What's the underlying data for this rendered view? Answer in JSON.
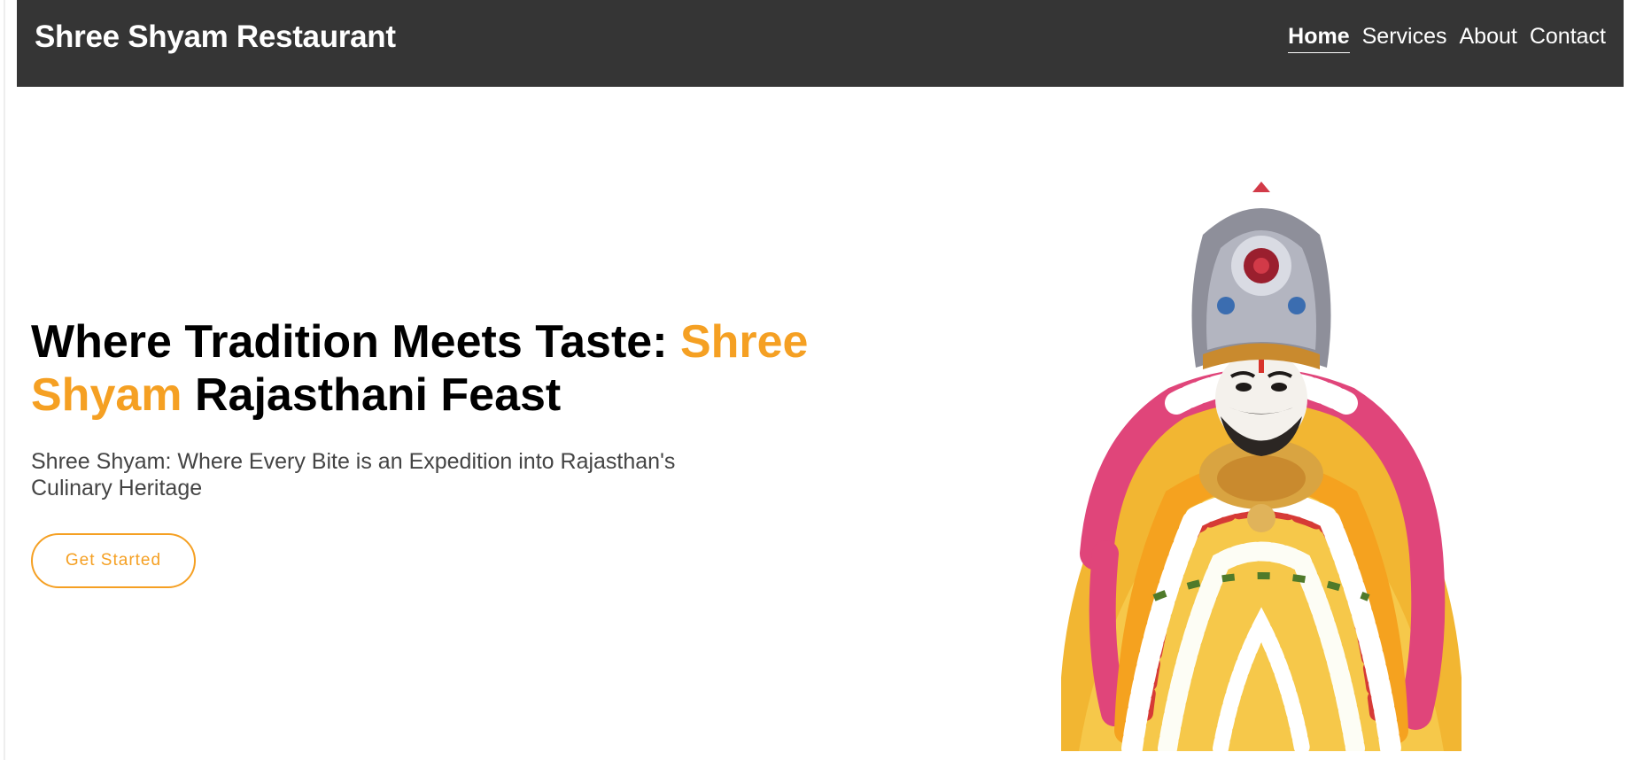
{
  "header": {
    "brand": "Shree Shyam Restaurant",
    "nav": [
      {
        "label": "Home",
        "active": true
      },
      {
        "label": "Services",
        "active": false
      },
      {
        "label": "About",
        "active": false
      },
      {
        "label": "Contact",
        "active": false
      }
    ]
  },
  "hero": {
    "title_part1": "Where Tradition Meets Taste: ",
    "title_accent": "Shree Shyam",
    "title_part2": " Rajasthani Feast",
    "subtitle": "Shree Shyam: Where Every Bite is an Expedition into Rajasthan's Culinary Heritage",
    "cta_label": "Get Started"
  },
  "colors": {
    "navbar_bg": "#353535",
    "accent": "#f5a023",
    "text_dark": "#000000",
    "text_muted": "#444444"
  },
  "image": {
    "icon": "deity-idol-with-garlands"
  }
}
